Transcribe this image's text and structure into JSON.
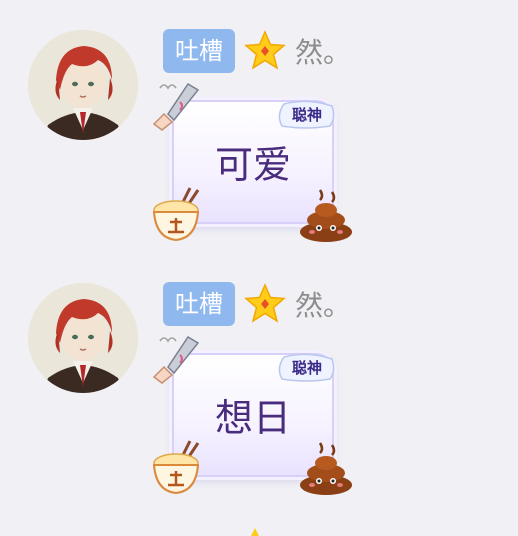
{
  "messages": [
    {
      "tag": "吐槽",
      "name": "然。",
      "bubble_badge": "聪神",
      "text": "可爱"
    },
    {
      "tag": "吐槽",
      "name": "然。",
      "bubble_badge": "聪神",
      "text": "想日"
    }
  ],
  "colors": {
    "background": "#f0f0f5",
    "tag_bg": "#8fb8ef",
    "bubble_text": "#4a2c7d",
    "name": "#8c8c8c"
  },
  "icons": [
    "avatar",
    "star-badge-icon",
    "knife-icon",
    "rice-bowl-icon",
    "poop-icon"
  ]
}
